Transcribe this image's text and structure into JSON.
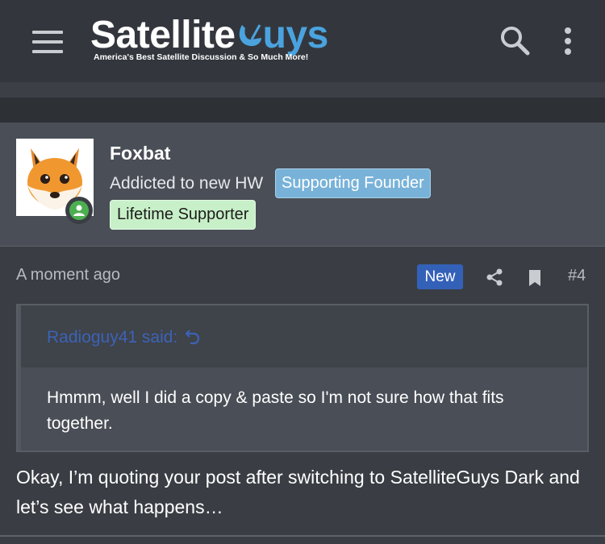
{
  "header": {
    "logo_word_white": "Satellite",
    "logo_word_blue": "uys",
    "tagline": "America's Best Satellite Discussion & So Much More!",
    "icons": [
      "menu-icon",
      "search-icon",
      "more-vertical-icon"
    ]
  },
  "post": {
    "user": {
      "name": "Foxbat",
      "title": "Addicted to new HW",
      "badges": [
        "Supporting Founder",
        "Lifetime Supporter"
      ],
      "status": "online"
    },
    "time": "A moment ago",
    "new_label": "New",
    "number": "#4",
    "quote": {
      "attribution": "Radioguy41 said:",
      "text": "Hmmm, well I did a copy & paste so I'm not sure how that fits together."
    },
    "body": "Okay, I’m quoting your post after switching to SatelliteGuys Dark and let’s see what happens…"
  },
  "colors": {
    "background": "#3a3e44",
    "header": "#33373d",
    "user_block": "#4a4e56",
    "logo_blue": "#4aa3df",
    "new_badge": "#3461b8",
    "quote_link": "#3c63b7",
    "founder_badge": "#78b2d9",
    "lifetime_badge": "#c8f0c8"
  }
}
